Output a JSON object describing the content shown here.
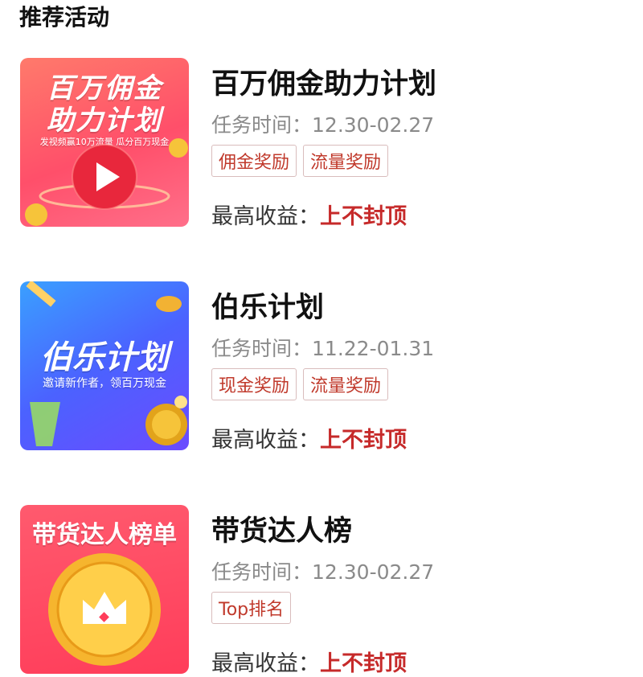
{
  "section": {
    "title": "推荐活动"
  },
  "activities": [
    {
      "thumb": {
        "line1": "百万佣金",
        "line2": "助力计划",
        "sub": "发视频赢10万流量 瓜分百万现金"
      },
      "title": "百万佣金助力计划",
      "time_label": "任务时间：",
      "time_range": "12.30-02.27",
      "tags": [
        "佣金奖励",
        "流量奖励"
      ],
      "reward_label": "最高收益：",
      "reward_value": "上不封顶"
    },
    {
      "thumb": {
        "line1": "伯乐计划",
        "sub": "邀请新作者，领百万现金"
      },
      "title": "伯乐计划",
      "time_label": "任务时间：",
      "time_range": "11.22-01.31",
      "tags": [
        "现金奖励",
        "流量奖励"
      ],
      "reward_label": "最高收益：",
      "reward_value": "上不封顶"
    },
    {
      "thumb": {
        "line1": "带货达人榜单"
      },
      "title": "带货达人榜",
      "time_label": "任务时间：",
      "time_range": "12.30-02.27",
      "tags": [
        "Top排名"
      ],
      "reward_label": "最高收益：",
      "reward_value": "上不封顶"
    }
  ]
}
